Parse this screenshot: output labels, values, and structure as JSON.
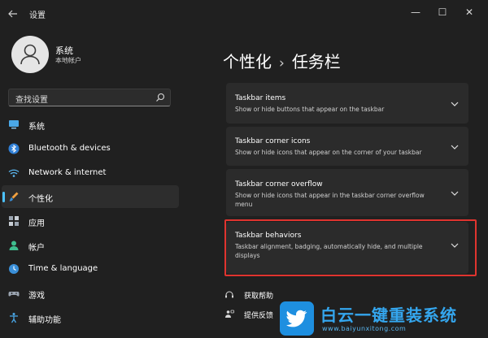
{
  "window": {
    "title": "设置",
    "back_icon": "back-arrow-icon",
    "minimize_glyph": "—",
    "maximize_glyph": "☐",
    "close_glyph": "✕"
  },
  "profile": {
    "name": "系统",
    "account_type": "本地帐户"
  },
  "search": {
    "placeholder": "查找设置"
  },
  "sidebar": {
    "items": [
      {
        "label": "系统",
        "icon": "display-icon",
        "active": false
      },
      {
        "label": "Bluetooth & devices",
        "icon": "bluetooth-icon",
        "active": false
      },
      {
        "label": "Network & internet",
        "icon": "wifi-icon",
        "active": false
      },
      {
        "label": "个性化",
        "icon": "brush-icon",
        "active": true
      },
      {
        "label": "应用",
        "icon": "apps-icon",
        "active": false
      },
      {
        "label": "帐户",
        "icon": "person-icon",
        "active": false
      },
      {
        "label": "Time & language",
        "icon": "globe-clock-icon",
        "active": false
      },
      {
        "label": "游戏",
        "icon": "gamepad-icon",
        "active": false
      },
      {
        "label": "辅助功能",
        "icon": "accessibility-icon",
        "active": false
      }
    ]
  },
  "breadcrumb": {
    "parent": "个性化",
    "separator": "›",
    "current": "任务栏"
  },
  "cards": [
    {
      "title": "Taskbar items",
      "description": "Show or hide buttons that appear on the taskbar"
    },
    {
      "title": "Taskbar corner icons",
      "description": "Show or hide icons that appear on the corner of your taskbar"
    },
    {
      "title": "Taskbar corner overflow",
      "description": "Show or hide icons that appear in the taskbar corner overflow menu"
    },
    {
      "title": "Taskbar behaviors",
      "description": "Taskbar alignment, badging, automatically hide, and multiple displays"
    }
  ],
  "links": {
    "help": "获取帮助",
    "feedback": "提供反馈"
  },
  "watermark": {
    "text": "白云一键重装系统",
    "url": "www.baiyunxitong.com"
  },
  "colors": {
    "accent": "#4cc2ff",
    "highlight_box": "#e0342f",
    "background": "#202020",
    "card": "#2b2b2b"
  }
}
